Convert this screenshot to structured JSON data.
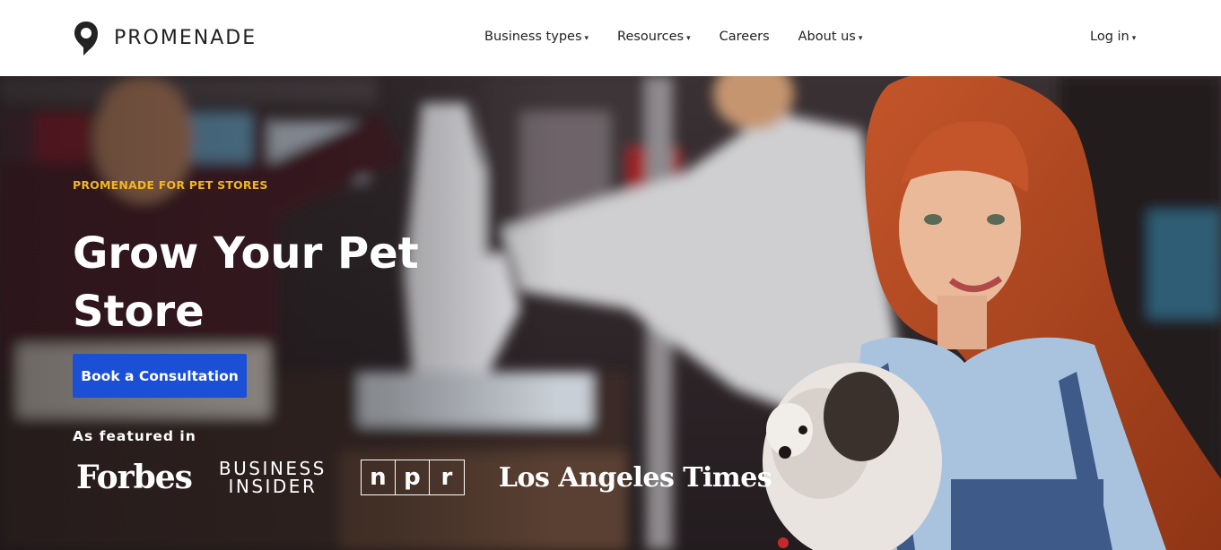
{
  "brand": {
    "name": "PROMENADE"
  },
  "nav": {
    "items": [
      {
        "label": "Business types",
        "has_dropdown": true
      },
      {
        "label": "Resources",
        "has_dropdown": true
      },
      {
        "label": "Careers",
        "has_dropdown": false
      },
      {
        "label": "About us",
        "has_dropdown": true
      }
    ],
    "login": "Log in"
  },
  "hero": {
    "eyebrow": "PROMENADE FOR PET STORES",
    "title": "Grow Your Pet Store",
    "cta": "Book a Consultation",
    "featured_label": "As featured in",
    "press": {
      "forbes": "Forbes",
      "business_insider_line1": "BUSINESS",
      "business_insider_line2": "INSIDER",
      "npr": [
        "n",
        "p",
        "r"
      ],
      "la_times": "Los Angeles Times"
    }
  },
  "colors": {
    "accent_blue": "#1a4fd6",
    "eyebrow_yellow": "#f2b61f",
    "text_dark": "#222222",
    "white": "#ffffff"
  },
  "icons": {
    "caret": "chevron-down-icon",
    "logo": "location-pin-icon"
  }
}
